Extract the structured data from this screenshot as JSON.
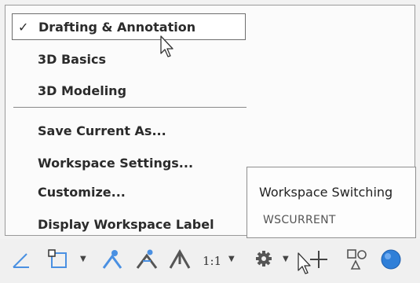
{
  "workspace_menu": {
    "items": [
      {
        "label": "Drafting & Annotation",
        "checked": true
      },
      {
        "label": "3D Basics"
      },
      {
        "label": "3D Modeling"
      },
      {
        "label": "Save Current As..."
      },
      {
        "label": "Workspace Settings..."
      },
      {
        "label": "Customize..."
      },
      {
        "label": "Display Workspace Label"
      }
    ],
    "check_glyph": "✓"
  },
  "tooltip": {
    "title": "Workspace Switching",
    "command": "WSCURRENT"
  },
  "statusbar": {
    "scale_label": "1:1",
    "icons": [
      "polar-tracking-icon",
      "object-snap-icon",
      "annotation-visibility-icon",
      "auto-scale-icon",
      "annotation-scale-icon",
      "workspace-gear-icon",
      "add-workspace-icon",
      "isolate-objects-icon",
      "hardware-acceleration-icon"
    ],
    "accent_color": "#2f7fd8"
  }
}
